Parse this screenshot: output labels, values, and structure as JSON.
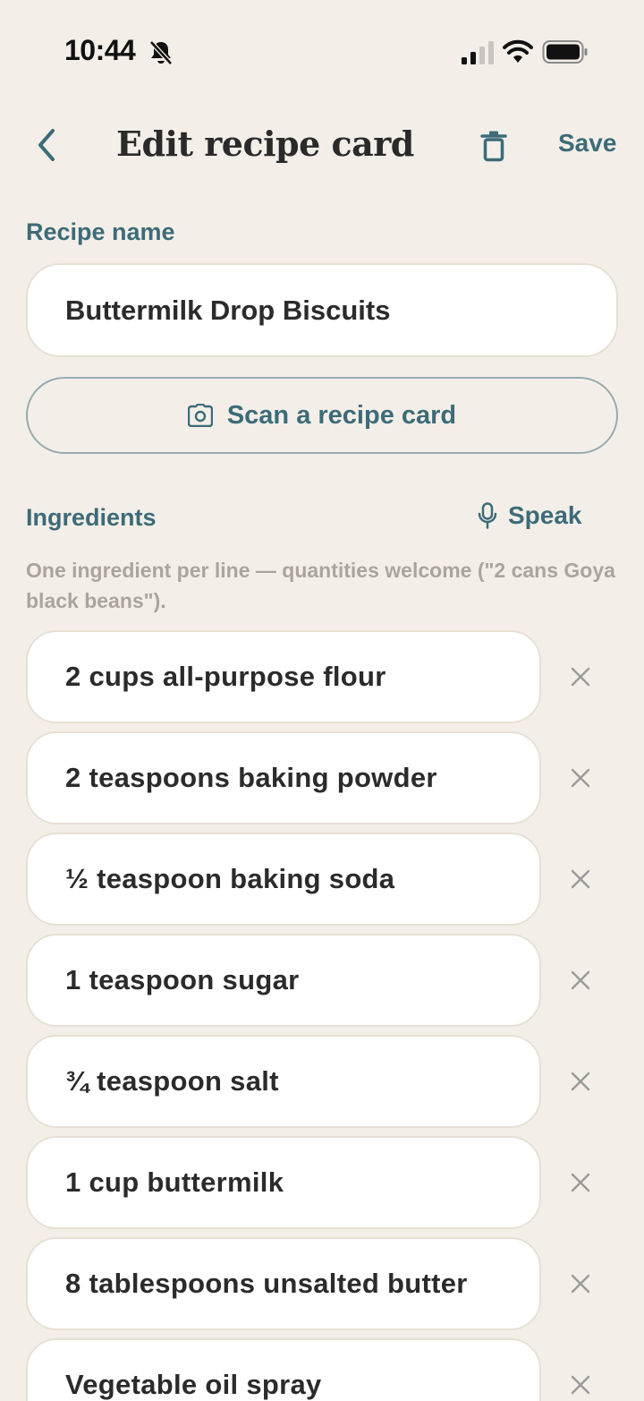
{
  "status_bar": {
    "time": "10:44"
  },
  "header": {
    "title": "Edit recipe card",
    "save_label": "Save"
  },
  "recipe_name": {
    "label": "Recipe name",
    "value": "Buttermilk Drop Biscuits"
  },
  "scan_button_label": "Scan a recipe card",
  "ingredients": {
    "label": "Ingredients",
    "speak_label": "Speak",
    "hint": "One ingredient per line — quantities welcome (\"2 cans Goya black beans\").",
    "items": [
      "2 cups all-purpose flour",
      "2 teaspoons baking powder",
      "½ teaspoon baking soda",
      "1 teaspoon sugar",
      "¾ teaspoon salt",
      "1 cup buttermilk",
      "8 tablespoons unsalted butter",
      "Vegetable oil spray"
    ]
  },
  "colors": {
    "accent": "#3d6b78",
    "background": "#f3efe8",
    "field": "#ffffff",
    "muted": "#aaa59c"
  }
}
